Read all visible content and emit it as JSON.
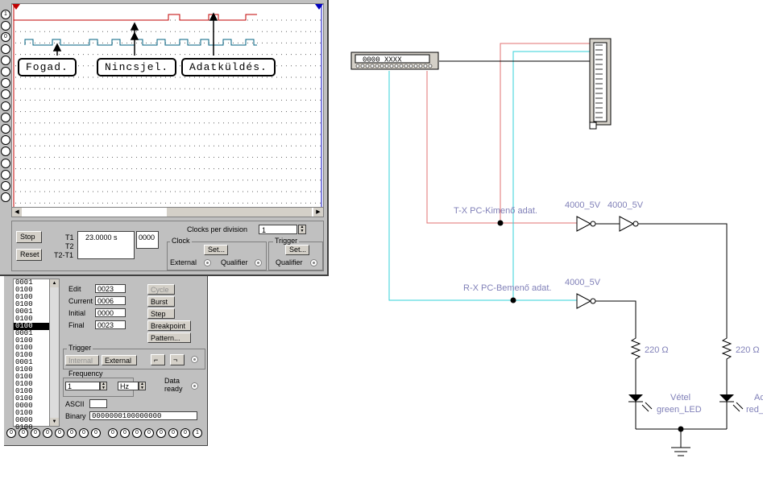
{
  "logic_analyzer": {
    "tooltips": [
      "Fogad.",
      "Nincsjel.",
      "Adatküldés."
    ],
    "stop_label": "Stop",
    "reset_label": "Reset",
    "t1_label": "T1",
    "t2_label": "T2",
    "t2t1_label": "T2-T1",
    "t1_value": "23.0000  s",
    "t_count": "0000",
    "clocks_per_division_label": "Clocks per division",
    "clocks_per_division_value": "1",
    "clock_group_label": "Clock",
    "trigger_group_label": "Trigger",
    "set_label": "Set...",
    "external_label": "External",
    "qualifier_label": "Qualifier",
    "left_terminals": [
      "1",
      "",
      "0",
      "",
      "",
      "",
      "",
      "",
      "",
      "",
      "",
      "",
      "",
      "",
      "",
      "",
      ""
    ]
  },
  "word_generator": {
    "words": [
      "0001",
      "0100",
      "0100",
      "0100",
      "0001",
      "0100",
      "0100",
      "0001",
      "0100",
      "0100",
      "0100",
      "0001",
      "0100",
      "0100",
      "0100",
      "0100",
      "0100",
      "0000",
      "0100",
      "0000",
      "0100"
    ],
    "selected_index": 6,
    "edit_label": "Edit",
    "edit_value": "0023",
    "current_label": "Current",
    "current_value": "0006",
    "initial_label": "Initial",
    "initial_value": "0000",
    "final_label": "Final",
    "final_value": "0023",
    "cycle_label": "Cycle",
    "burst_label": "Burst",
    "step_label": "Step",
    "breakpoint_label": "Breakpoint",
    "pattern_label": "Pattern...",
    "trigger_label": "Trigger",
    "internal_label": "Internal",
    "external_label": "External",
    "frequency_label": "Frequency",
    "frequency_value": "1",
    "frequency_unit": "Hz",
    "data_label": "Data",
    "ready_label": "ready",
    "ascii_label": "ASCII",
    "ascii_value": "",
    "binary_label": "Binary",
    "binary_value": "0000000100000000",
    "terminals": [
      "0",
      "0",
      "0",
      "0",
      "0",
      "0",
      "0",
      "0",
      "0",
      "0",
      "0",
      "0",
      "0",
      "0",
      "0",
      "1"
    ]
  },
  "circuit": {
    "generator_display": "0000 XXXX",
    "tx_label": "T-X PC-Kimenő adat.",
    "rx_label": "R-X PC-Bemenő adat.",
    "gate_labels": [
      "4000_5V",
      "4000_5V",
      "4000_5V"
    ],
    "resistor_labels": [
      "220 Ω",
      "220 Ω"
    ],
    "led_left_title": "Vétel",
    "led_left_model": "green_LED",
    "led_right_title": "Ad",
    "led_right_model": "red_",
    "colors": {
      "red_wire": "#e07070",
      "cyan_wire": "#30d0d8",
      "label": "#8080b8",
      "trace_red": "#c00000",
      "trace_teal": "#006080"
    }
  }
}
